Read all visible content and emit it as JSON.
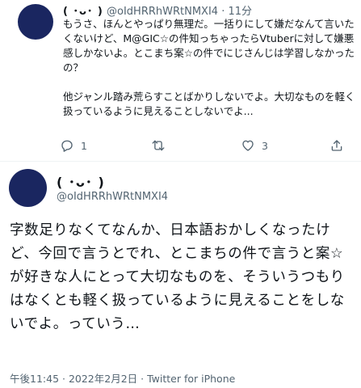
{
  "reply_tweet": {
    "display_name": "( ･ᴗ･ )",
    "handle": "@oIdHRRhWRtNMXI4",
    "time": "11分",
    "paragraph1": "もうさ、ほんとやっぱり無理だ。一括りにして嫌だなんて言いたくないけど、M@GIC☆の件知っちゃったらVtuberに対して嫌悪感しかないよ。とこまち案☆の件でにじさんじは学習しなかったの？",
    "paragraph2": "他ジャンル踏み荒らすことばかりしないでよ。大切なものを軽く扱っているように見えることしないでよ...",
    "reply_count": "1",
    "retweet_count": "",
    "like_count": "3",
    "icons": [
      "reply-icon",
      "retweet-icon",
      "like-icon",
      "share-icon"
    ]
  },
  "main_tweet": {
    "display_name": "( ･ᴗ･ )",
    "handle": "@oIdHRRhWRtNMXI4",
    "text": "字数足りなくてなんか、日本語おかしくなったけど、今回で言うとでれ、とこまちの件で言うと案☆が好きな人にとって大切なものを、そういうつもりはなくとも軽く扱っているように見えることをしないでよ。っていう…",
    "timestamp": "午後11:45 · 2022年2月2日 · ",
    "source": "Twitter for iPhone"
  },
  "colors": {
    "avatar": "#1a2660",
    "secondary_text": "#536471",
    "primary_text": "#0f1419"
  }
}
